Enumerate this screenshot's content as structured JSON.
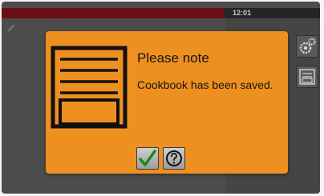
{
  "status": {
    "clock": "12:01",
    "progress_fraction": 0.7,
    "progress_color": "#6a1016"
  },
  "dialog": {
    "title": "Please note",
    "message": "Cookbook has been saved.",
    "background_color": "#ee901f",
    "icon": "cookbook-icon",
    "confirm_icon": "checkmark-icon",
    "confirm_color": "#1a8a1a",
    "help_icon": "help-icon"
  },
  "side": {
    "icons": [
      "edit-icon",
      "settings-icon",
      "cookbook-icon"
    ]
  }
}
